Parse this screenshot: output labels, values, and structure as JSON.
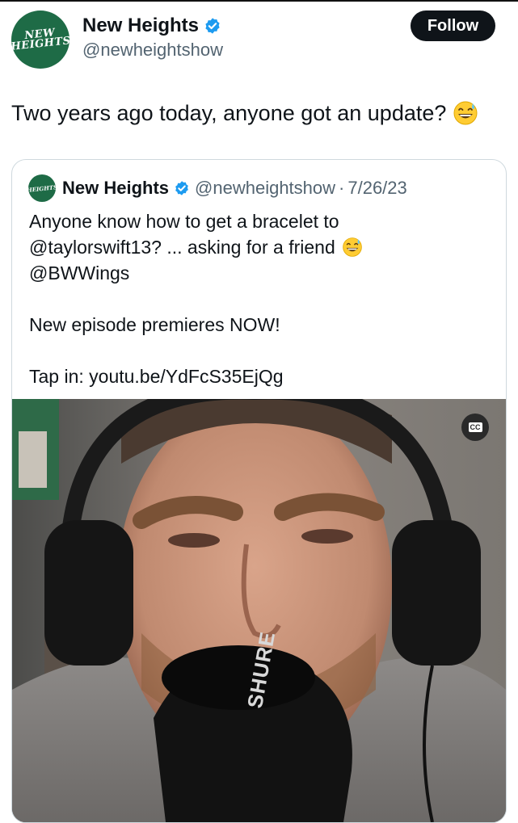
{
  "author": {
    "name": "New Heights",
    "handle": "@newheightshow",
    "avatar_text_line1": "NEW",
    "avatar_text_line2": "HEIGHTS"
  },
  "follow_label": "Follow",
  "post_text": "Two years ago today, anyone got an update?",
  "post_emoji": "grinning-sweat-emoji",
  "quoted": {
    "name": "New Heights",
    "handle": "@newheightshow",
    "separator": "·",
    "date": "7/26/23",
    "lines": [
      "Anyone know how to get a bracelet to",
      "@taylorswift13? ... asking for a friend",
      "@BWWings"
    ],
    "line_episode": "New episode premieres NOW!",
    "line_link": "Tap in: youtu.be/YdFcS35EjQg"
  },
  "video": {
    "cc_label": "CC",
    "mic_brand": "SHURE"
  },
  "colors": {
    "brand_green": "#1e6b46",
    "verified_blue": "#1d9bf0",
    "text_primary": "#0f1419",
    "text_secondary": "#536471"
  }
}
